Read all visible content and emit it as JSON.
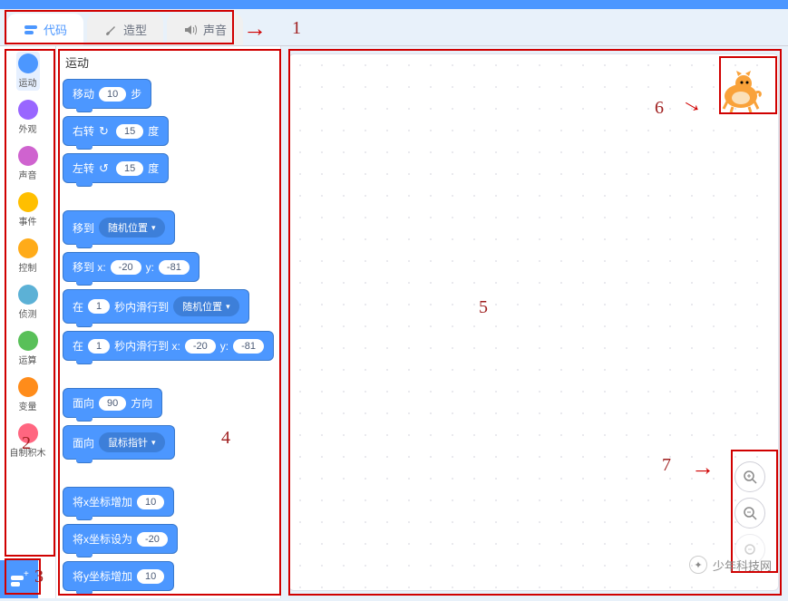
{
  "tabs": {
    "code": "代码",
    "costumes": "造型",
    "sounds": "声音"
  },
  "categories": [
    {
      "name": "运动",
      "color": "#4c97ff",
      "selected": true
    },
    {
      "name": "外观",
      "color": "#9966ff"
    },
    {
      "name": "声音",
      "color": "#cf63cf"
    },
    {
      "name": "事件",
      "color": "#ffbf00"
    },
    {
      "name": "控制",
      "color": "#ffab19"
    },
    {
      "name": "侦测",
      "color": "#5cb1d6"
    },
    {
      "name": "运算",
      "color": "#59c059"
    },
    {
      "name": "变量",
      "color": "#ff8c1a"
    },
    {
      "name": "自制积木",
      "color": "#ff6680"
    }
  ],
  "palette_title": "运动",
  "blocks": {
    "move": {
      "pre": "移动",
      "v": "10",
      "post": "步"
    },
    "turn_r": {
      "pre": "右转",
      "icon": "↻",
      "v": "15",
      "post": "度"
    },
    "turn_l": {
      "pre": "左转",
      "icon": "↺",
      "v": "15",
      "post": "度"
    },
    "goto_menu": {
      "pre": "移到",
      "dd": "随机位置"
    },
    "goto_xy": {
      "pre": "移到 x:",
      "x": "-20",
      "mid": "y:",
      "y": "-81"
    },
    "glide_menu": {
      "pre": "在",
      "s": "1",
      "mid": "秒内滑行到",
      "dd": "随机位置"
    },
    "glide_xy": {
      "pre": "在",
      "s": "1",
      "mid": "秒内滑行到 x:",
      "x": "-20",
      "mid2": "y:",
      "y": "-81"
    },
    "point_dir": {
      "pre": "面向",
      "v": "90",
      "post": "方向"
    },
    "point_to": {
      "pre": "面向",
      "dd": "鼠标指针"
    },
    "change_x": {
      "pre": "将x坐标增加",
      "v": "10"
    },
    "set_x": {
      "pre": "将x坐标设为",
      "v": "-20"
    },
    "change_y": {
      "pre": "将y坐标增加",
      "v": "10"
    }
  },
  "annotations": {
    "1": "1",
    "2": "2",
    "3": "3",
    "4": "4",
    "5": "5",
    "6": "6",
    "7": "7"
  },
  "watermark": "少年科技网"
}
